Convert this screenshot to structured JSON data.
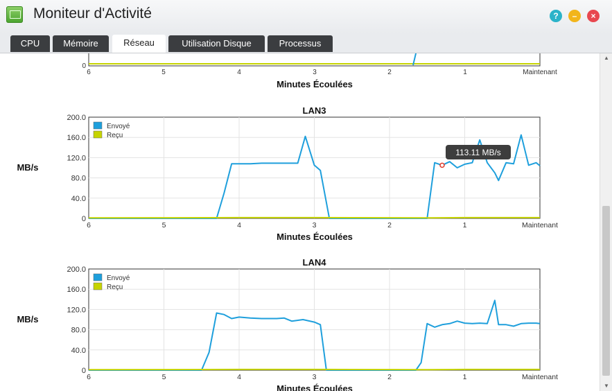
{
  "window": {
    "title": "Moniteur d'Activité"
  },
  "tabs": [
    {
      "label": "CPU",
      "active": false
    },
    {
      "label": "Mémoire",
      "active": false
    },
    {
      "label": "Réseau",
      "active": true
    },
    {
      "label": "Utilisation Disque",
      "active": false
    },
    {
      "label": "Processus",
      "active": false
    }
  ],
  "icons": {
    "help": "help-icon",
    "minimize": "minimize-icon",
    "close": "close-icon",
    "app": "activity-monitor-icon"
  },
  "colors": {
    "sent": "#1e9fdc",
    "received": "#c6d400"
  },
  "top_chart": {
    "x_ticks": [
      "6",
      "5",
      "4",
      "3",
      "2",
      "1",
      "Maintenant"
    ],
    "xlabel": "Minutes Écoulées",
    "y_ticks": [
      "0"
    ]
  },
  "chart_data": [
    {
      "type": "line",
      "title": "LAN3",
      "ylabel": "MB/s",
      "xlabel": "Minutes Écoulées",
      "ylim": [
        0,
        200
      ],
      "xlim": [
        6,
        0
      ],
      "y_ticks": [
        "0",
        "40.0",
        "80.0",
        "120.0",
        "160.0",
        "200.0"
      ],
      "x_ticks": [
        "6",
        "5",
        "4",
        "3",
        "2",
        "1",
        "Maintenant"
      ],
      "legend": [
        "Envoyé",
        "Reçu"
      ],
      "tooltip": "113.11 MB/s",
      "series": [
        {
          "name": "Envoyé",
          "color": "#1e9fdc",
          "x": [
            6,
            4.4,
            4.3,
            4.2,
            4.1,
            4.0,
            3.85,
            3.7,
            3.5,
            3.3,
            3.22,
            3.12,
            3.0,
            2.92,
            2.8,
            2.6,
            1.5,
            1.4,
            1.3,
            1.2,
            1.1,
            1.0,
            0.9,
            0.8,
            0.7,
            0.6,
            0.55,
            0.45,
            0.35,
            0.25,
            0.15,
            0.05,
            0.0
          ],
          "values": [
            0,
            0,
            0,
            50,
            108,
            108,
            108,
            109,
            109,
            109,
            109,
            162,
            105,
            95,
            0,
            0,
            0,
            110,
            105,
            112,
            100,
            107,
            110,
            155,
            110,
            90,
            75,
            110,
            108,
            165,
            105,
            110,
            104
          ]
        },
        {
          "name": "Reçu",
          "color": "#c6d400",
          "x": [
            6,
            4.0,
            3.0,
            1.5,
            1.0,
            0.0
          ],
          "values": [
            1,
            1.5,
            1.5,
            1,
            1.5,
            1.5
          ]
        }
      ]
    },
    {
      "type": "line",
      "title": "LAN4",
      "ylabel": "MB/s",
      "xlabel": "Minutes Écoulées",
      "ylim": [
        0,
        200
      ],
      "xlim": [
        6,
        0
      ],
      "y_ticks": [
        "0",
        "40.0",
        "80.0",
        "120.0",
        "160.0",
        "200.0"
      ],
      "x_ticks": [
        "6",
        "5",
        "4",
        "3",
        "2",
        "1",
        "Maintenant"
      ],
      "legend": [
        "Envoyé",
        "Reçu"
      ],
      "series": [
        {
          "name": "Envoyé",
          "color": "#1e9fdc",
          "x": [
            6,
            4.5,
            4.4,
            4.3,
            4.2,
            4.1,
            4.0,
            3.85,
            3.7,
            3.5,
            3.4,
            3.3,
            3.15,
            3.0,
            2.92,
            2.84,
            2.6,
            1.65,
            1.58,
            1.5,
            1.4,
            1.3,
            1.2,
            1.1,
            1.0,
            0.9,
            0.8,
            0.7,
            0.6,
            0.55,
            0.45,
            0.35,
            0.25,
            0.15,
            0.05,
            0.0
          ],
          "values": [
            0,
            0,
            35,
            113,
            110,
            102,
            105,
            103,
            102,
            102,
            103,
            97,
            100,
            95,
            90,
            0,
            0,
            0,
            15,
            92,
            85,
            90,
            92,
            97,
            93,
            92,
            93,
            92,
            138,
            90,
            90,
            87,
            92,
            93,
            93,
            92
          ]
        },
        {
          "name": "Reçu",
          "color": "#c6d400",
          "x": [
            6,
            4.0,
            3.0,
            1.5,
            1.0,
            0.0
          ],
          "values": [
            1,
            1.5,
            1.5,
            1,
            1.5,
            1.5
          ]
        }
      ]
    }
  ]
}
